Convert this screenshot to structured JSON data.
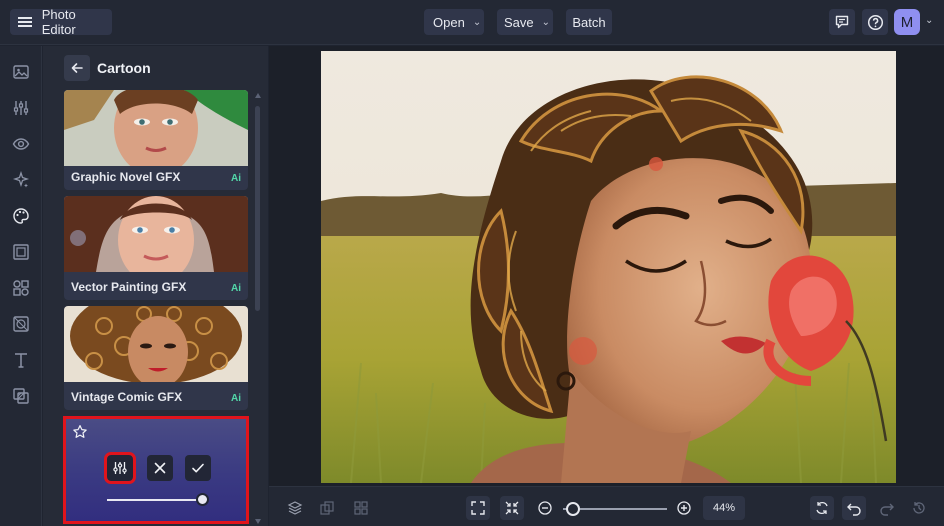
{
  "header": {
    "app_title": "Photo Editor",
    "open_label": "Open",
    "save_label": "Save",
    "batch_label": "Batch",
    "avatar_initial": "M"
  },
  "sidebar_tools": [
    {
      "icon": "image-icon"
    },
    {
      "icon": "adjust-sliders-icon"
    },
    {
      "icon": "eye-icon"
    },
    {
      "icon": "sparkle-icon"
    },
    {
      "icon": "palette-icon",
      "active": true
    },
    {
      "icon": "frame-icon"
    },
    {
      "icon": "shapes-icon"
    },
    {
      "icon": "texture-icon"
    },
    {
      "icon": "text-icon"
    },
    {
      "icon": "overlay-icon"
    }
  ],
  "panel": {
    "title": "Cartoon",
    "effects": [
      {
        "label": "Graphic Novel GFX",
        "badge": "Ai"
      },
      {
        "label": "Vector Painting GFX",
        "badge": "Ai"
      },
      {
        "label": "Vintage Comic GFX",
        "badge": "Ai"
      }
    ],
    "selected_effect": {
      "intensity": 1.0
    }
  },
  "bottom_bar": {
    "zoom_value": "44%",
    "zoom_fraction": 0.1
  },
  "colors": {
    "accent": "#8f8ff0",
    "highlight": "#e0141c",
    "ai_badge": "#52d7a8",
    "effect_gradient_end": "#322e7f"
  }
}
